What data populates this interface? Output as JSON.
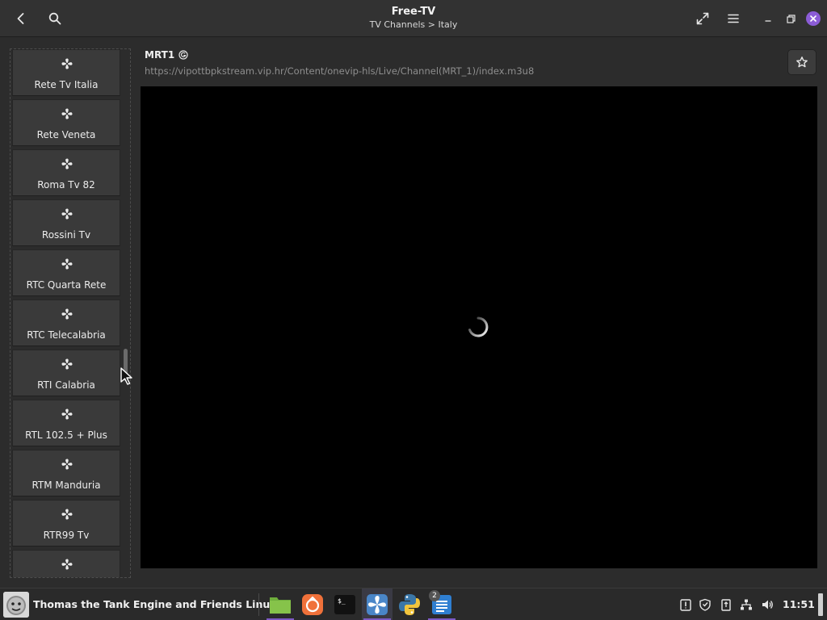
{
  "header": {
    "title": "Free-TV",
    "subtitle": "TV Channels > Italy"
  },
  "sidebar": {
    "channels": [
      {
        "label": "Rete Tv Italia"
      },
      {
        "label": "Rete Veneta"
      },
      {
        "label": "Roma Tv 82"
      },
      {
        "label": "Rossini Tv"
      },
      {
        "label": "RTC Quarta Rete"
      },
      {
        "label": "RTC Telecalabria"
      },
      {
        "label": "RTI Calabria"
      },
      {
        "label": "RTL 102.5 + Plus"
      },
      {
        "label": "RTM Manduria"
      },
      {
        "label": "RTR99 Tv"
      },
      {
        "label": ""
      }
    ]
  },
  "player": {
    "channel_name": "MRT1",
    "badge_icon": "geo-blocked-icon",
    "stream_url": "https://vipottbpkstream.vip.hr/Content/onevip-hls/Live/Channel(MRT_1)/index.m3u8"
  },
  "taskbar": {
    "window_title": "Thomas the Tank Engine and Friends Linux",
    "launchers": [
      {
        "icon": "files-folder-icon"
      },
      {
        "icon": "software-center-icon"
      },
      {
        "icon": "terminal-icon"
      },
      {
        "icon": "freetv-app-icon"
      },
      {
        "icon": "python-icon"
      },
      {
        "icon": "text-editor-icon",
        "count": "2"
      }
    ],
    "clock": "11:51"
  },
  "colors": {
    "accent": "#8b5cd6",
    "background": "#2c2c2c",
    "video_bg": "#000000"
  }
}
